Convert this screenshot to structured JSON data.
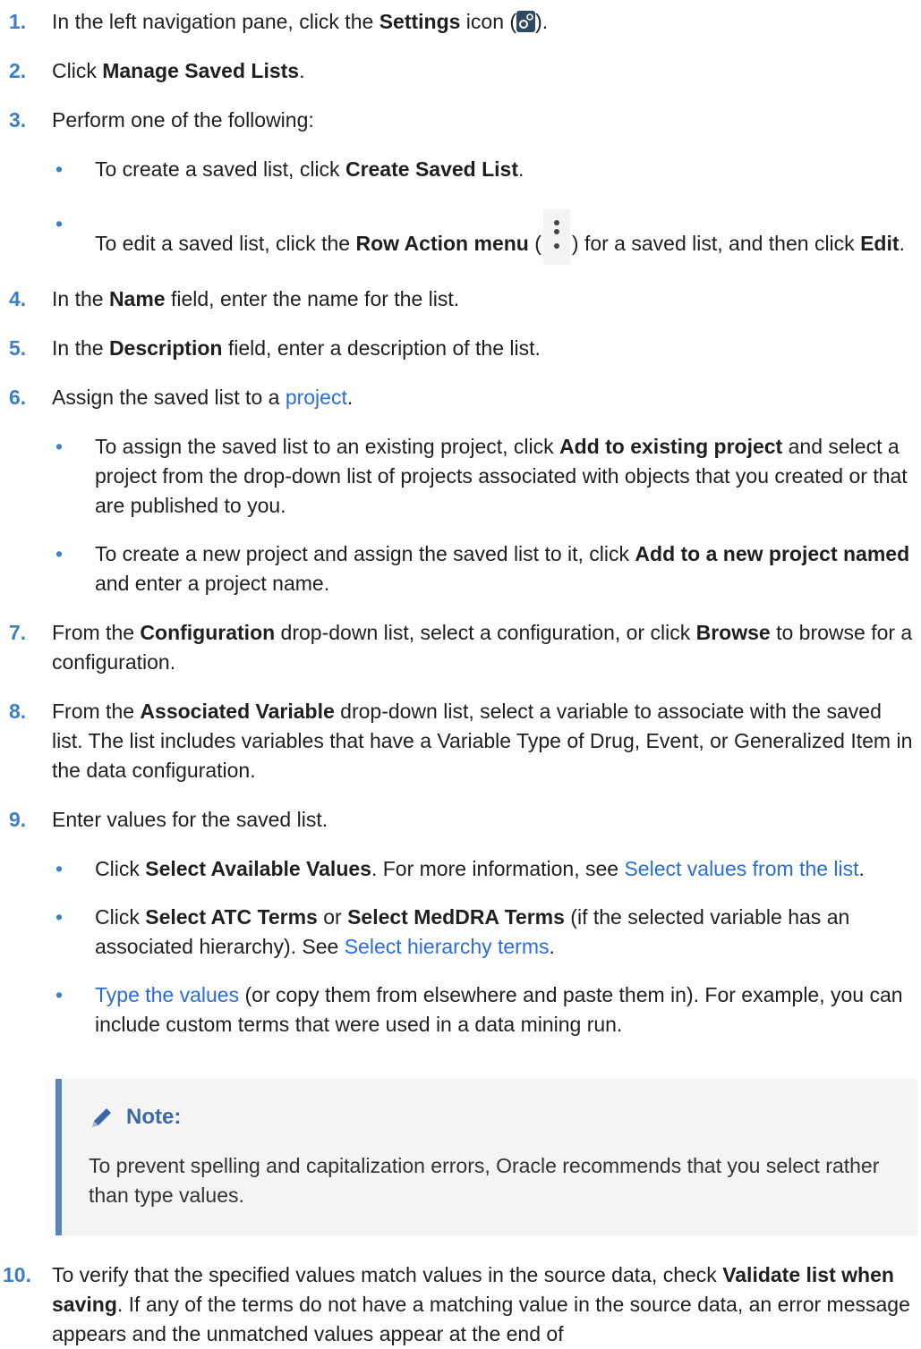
{
  "steps": [
    {
      "num": "1.",
      "parts": [
        "In the left navigation pane, click the ",
        "Settings",
        " icon (",
        ")."
      ],
      "icon": "settings-icon"
    },
    {
      "num": "2.",
      "parts": [
        "Click ",
        "Manage Saved Lists",
        "."
      ]
    },
    {
      "num": "3.",
      "text": "Perform one of the following:",
      "bullets": [
        {
          "parts": [
            "To create a saved list, click ",
            "Create Saved List",
            "."
          ]
        },
        {
          "parts": [
            "To edit a saved list, click the ",
            "Row Action menu",
            " (",
            ") for a saved list, and then click ",
            "Edit",
            "."
          ],
          "icon": "row-action-menu-icon"
        }
      ]
    },
    {
      "num": "4.",
      "parts": [
        "In the ",
        "Name",
        " field, enter the name for the list."
      ]
    },
    {
      "num": "5.",
      "parts": [
        "In the ",
        "Description",
        " field, enter a description of the list."
      ]
    },
    {
      "num": "6.",
      "parts": [
        "Assign the saved list to a ",
        "project",
        "."
      ],
      "bullets": [
        {
          "parts": [
            "To assign the saved list to an existing project, click ",
            "Add to existing project",
            " and select a project from the drop-down list of projects associated with objects that you created or that are published to you."
          ]
        },
        {
          "parts": [
            "To create a new project and assign the saved list to it, click ",
            "Add to a new project named",
            " and enter a project name."
          ]
        }
      ]
    },
    {
      "num": "7.",
      "parts": [
        "From the ",
        "Configuration",
        " drop-down list, select a configuration, or click ",
        "Browse",
        " to browse for a configuration."
      ]
    },
    {
      "num": "8.",
      "parts": [
        "From the ",
        "Associated Variable",
        " drop-down list, select a variable to associate with the saved list. The list includes variables that have a Variable Type of Drug, Event, or Generalized Item in the data configuration."
      ]
    },
    {
      "num": "9.",
      "text": "Enter values for the saved list.",
      "bullets": [
        {
          "parts": [
            "Click ",
            "Select Available Values",
            ". For more information, see ",
            "Select values from the list",
            "."
          ]
        },
        {
          "parts": [
            "Click ",
            "Select ATC Terms",
            " or ",
            "Select MedDRA Terms",
            " (if the selected variable has an associated hierarchy). See ",
            "Select hierarchy terms",
            "."
          ]
        },
        {
          "parts": [
            "Type the values",
            " (or copy them from elsewhere and paste them in). For example, you can include custom terms that were used in a data mining run."
          ]
        }
      ],
      "note": {
        "title": "Note:",
        "text": "To prevent spelling and capitalization errors, Oracle recommends that you select rather than type values."
      }
    },
    {
      "num": "10.",
      "parts": [
        "To verify that the specified values match values in the source data, check ",
        "Validate list when saving",
        ". If any of the terms do not have a matching value in the source data, an error message appears and the unmatched values appear at the end of"
      ]
    }
  ],
  "colors": {
    "accent": "#3d7fc4",
    "link": "#2a6dd8",
    "note_border": "#5b84b6",
    "note_bg": "#f4f4f2"
  }
}
